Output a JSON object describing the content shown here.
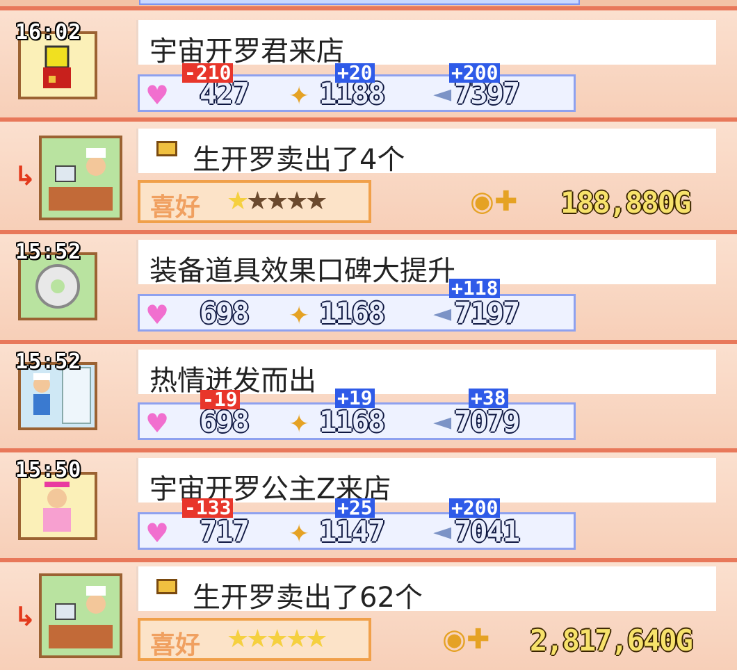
{
  "entries": [
    {
      "time": "16:02",
      "message": "宇宙开罗君来店",
      "heart": "427",
      "stamp": "1188",
      "talk": "7397",
      "delta_heart": "-210",
      "delta_stamp": "+20",
      "delta_talk": "+200"
    },
    {
      "message": "生开罗卖出了4个",
      "pref_label": "喜好",
      "stars": 1,
      "money": "188,880G"
    },
    {
      "time": "15:52",
      "message": "装备道具效果口碑大提升",
      "heart": "698",
      "stamp": "1168",
      "talk": "7197",
      "delta_talk": "+118"
    },
    {
      "time": "15:52",
      "message": "热情迸发而出",
      "heart": "698",
      "stamp": "1168",
      "talk": "7079",
      "delta_heart": "-19",
      "delta_stamp": "+19",
      "delta_talk": "+38"
    },
    {
      "time": "15:50",
      "message": "宇宙开罗公主Z来店",
      "heart": "717",
      "stamp": "1147",
      "talk": "7041",
      "delta_heart": "-133",
      "delta_stamp": "+25",
      "delta_talk": "+200"
    },
    {
      "message": "生开罗卖出了62个",
      "pref_label": "喜好",
      "stars": 5,
      "money": "2,817,640G"
    }
  ],
  "icons": {
    "heart": "heart-icon",
    "stamp": "stamp-icon",
    "talk": "speech-bubble-icon",
    "coin": "coin-icon",
    "plus": "plus-icon",
    "arrow": "return-arrow-icon",
    "star": "star-icon"
  },
  "colors": {
    "border": "#e8785a",
    "heart": "#f16fcf",
    "gold": "#e5a224",
    "red_delta": "#e8362b",
    "blue_delta": "#2f5be8"
  }
}
